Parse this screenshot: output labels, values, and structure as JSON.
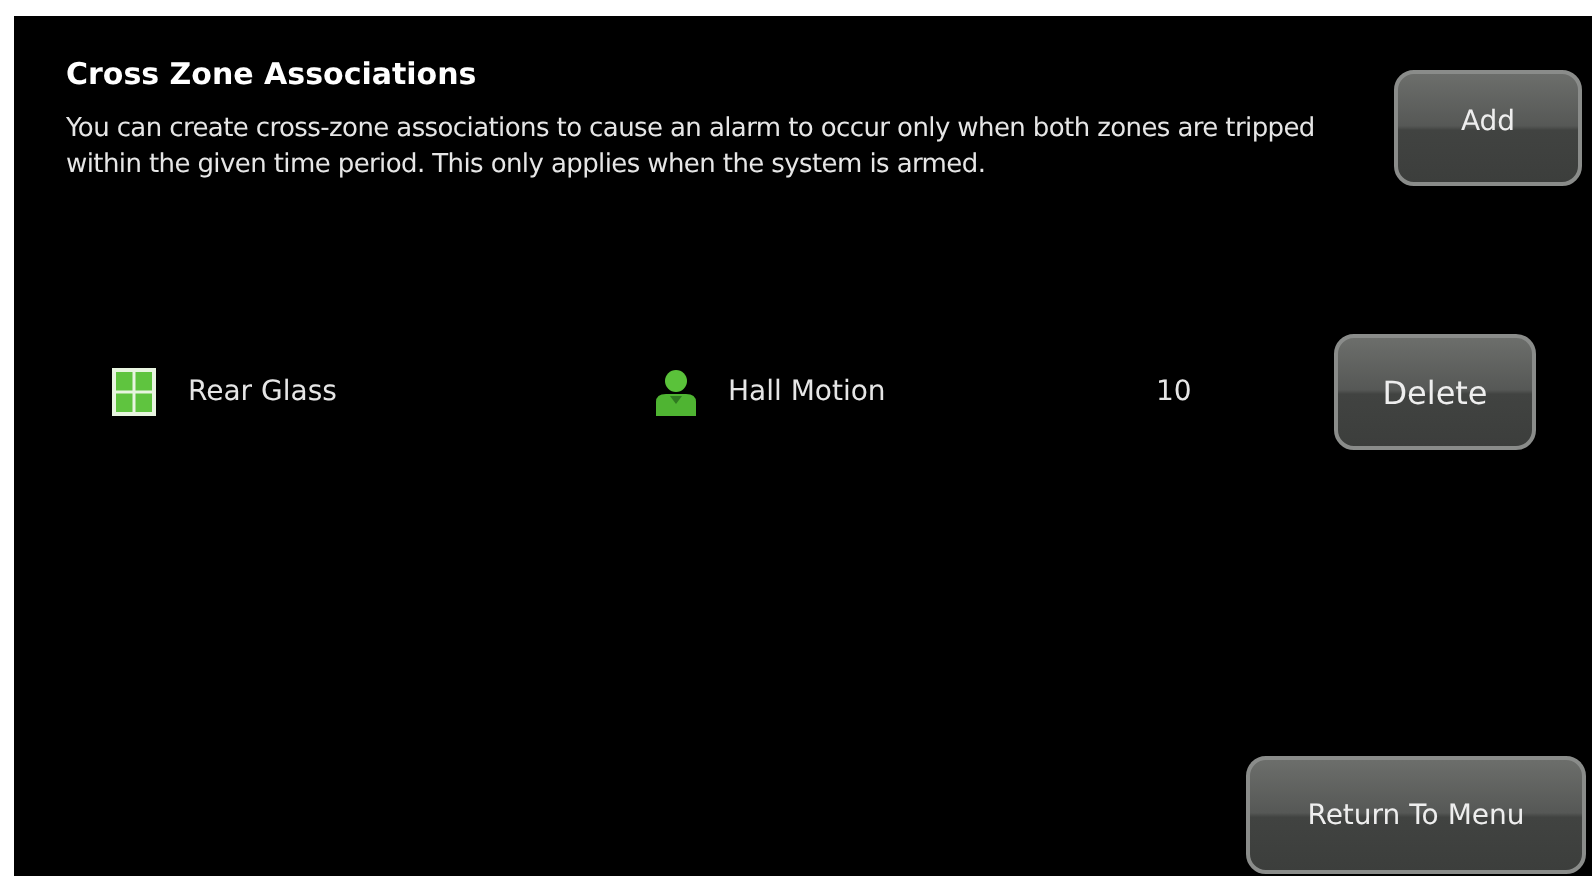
{
  "title": "Cross Zone Associations",
  "description": "You can create cross-zone associations to cause an alarm to occur only when both zones are tripped within the given time period.  This only applies when the system is armed.",
  "add_button": "Add",
  "associations": [
    {
      "zone_1": {
        "kind": "window",
        "name": "Rear Glass"
      },
      "zone_2": {
        "kind": "motion",
        "name": "Hall Motion"
      },
      "time": "10",
      "delete_button": "Delete"
    }
  ],
  "return_button": "Return To Menu"
}
